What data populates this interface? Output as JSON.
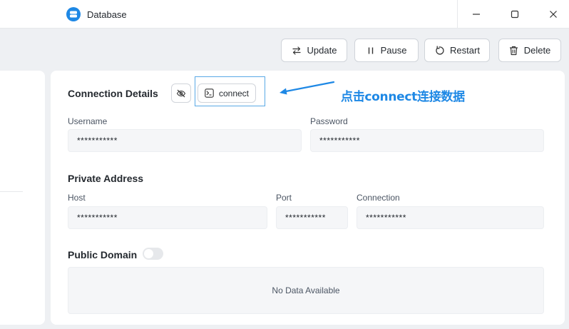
{
  "window": {
    "title": "Database",
    "app_icon": "database-icon",
    "controls": [
      "minimize-icon",
      "maximize-icon",
      "close-icon"
    ]
  },
  "toolbar": {
    "update_label": "Update",
    "pause_label": "Pause",
    "restart_label": "Restart",
    "delete_label": "Delete"
  },
  "connection": {
    "title": "Connection Details",
    "hide_icon": "eye-off-icon",
    "connect_label": "connect",
    "annotation": "点击connect连接数据",
    "username": {
      "label": "Username",
      "value": "***********"
    },
    "password": {
      "label": "Password",
      "value": "***********"
    }
  },
  "private_address": {
    "title": "Private Address",
    "host": {
      "label": "Host",
      "value": "***********"
    },
    "port": {
      "label": "Port",
      "value": "***********"
    },
    "connection": {
      "label": "Connection",
      "value": "***********"
    }
  },
  "public_domain": {
    "title": "Public Domain",
    "enabled": false,
    "empty_text": "No Data Available"
  },
  "colors": {
    "accent": "#1e88e5",
    "highlight": "#5aa9e6",
    "field_bg": "#f5f6f8",
    "page_bg": "#eef0f3"
  }
}
